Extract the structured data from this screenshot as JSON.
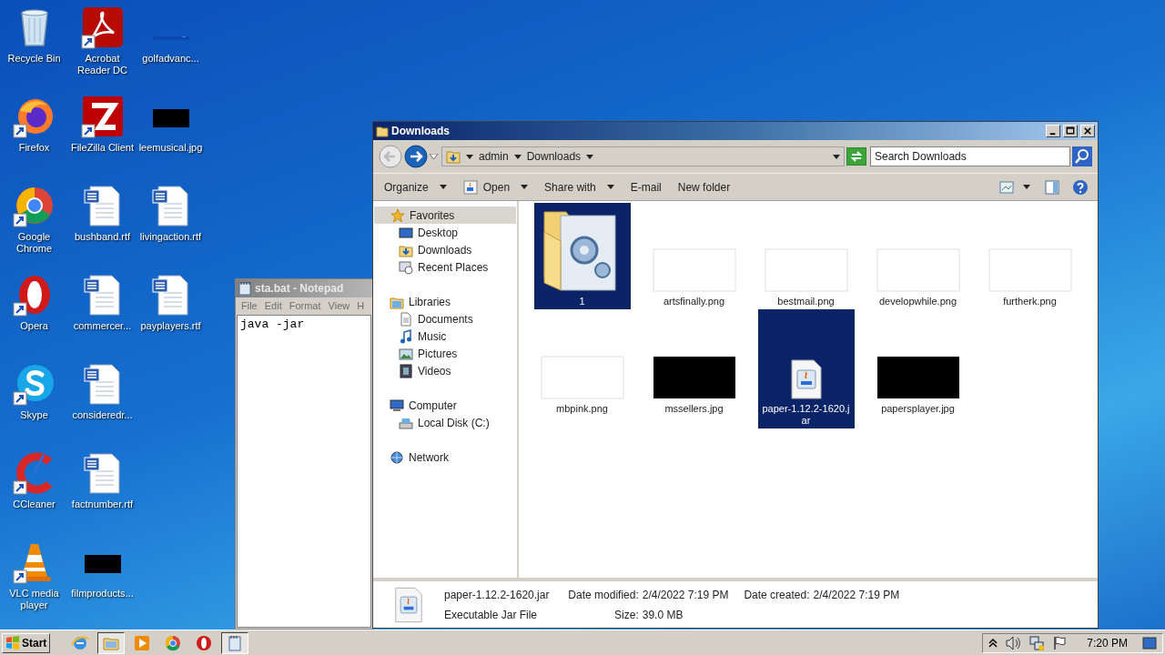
{
  "desktop_icons": [
    {
      "label": "Recycle Bin",
      "kind": "recycle",
      "shortcut": false
    },
    {
      "label": "Firefox",
      "kind": "firefox",
      "shortcut": true
    },
    {
      "label": "Google Chrome",
      "kind": "chrome",
      "shortcut": true
    },
    {
      "label": "Opera",
      "kind": "opera",
      "shortcut": true
    },
    {
      "label": "Skype",
      "kind": "skype",
      "shortcut": true
    },
    {
      "label": "CCleaner",
      "kind": "ccleaner",
      "shortcut": true
    },
    {
      "label": "VLC media player",
      "kind": "vlc",
      "shortcut": true
    },
    {
      "label": "Acrobat Reader DC",
      "kind": "acrobat",
      "shortcut": true
    },
    {
      "label": "FileZilla Client",
      "kind": "filezilla",
      "shortcut": true
    },
    {
      "label": "bushband.rtf",
      "kind": "word",
      "shortcut": false
    },
    {
      "label": "commercer...",
      "kind": "word",
      "shortcut": false
    },
    {
      "label": "consideredr...",
      "kind": "word",
      "shortcut": false
    },
    {
      "label": "factnumber.rtf",
      "kind": "word",
      "shortcut": false
    },
    {
      "label": "filmproducts...",
      "kind": "dark_image",
      "shortcut": false
    },
    {
      "label": "golfadvanc...",
      "kind": "blank_image",
      "shortcut": false
    },
    {
      "label": "leemusical.jpg",
      "kind": "dark_image",
      "shortcut": false
    },
    {
      "label": "livingaction.rtf",
      "kind": "word",
      "shortcut": false
    },
    {
      "label": "payplayers.rtf",
      "kind": "word",
      "shortcut": false
    }
  ],
  "notepad": {
    "title": "sta.bat - Notepad",
    "menu": [
      "File",
      "Edit",
      "Format",
      "View",
      "H"
    ],
    "text": "java -jar"
  },
  "explorer": {
    "title": "Downloads",
    "breadcrumb": [
      "admin",
      "Downloads"
    ],
    "search": {
      "placeholder": "Search Downloads"
    },
    "toolbar": [
      {
        "label": "Organize",
        "dropdown": true,
        "icon": false
      },
      {
        "label": "Open",
        "dropdown": true,
        "icon": true
      },
      {
        "label": "Share with",
        "dropdown": true,
        "icon": false
      },
      {
        "label": "E-mail",
        "dropdown": false,
        "icon": false
      },
      {
        "label": "New folder",
        "dropdown": false,
        "icon": false
      }
    ],
    "nav": [
      {
        "label": "Favorites",
        "kind": "star",
        "children": [
          {
            "label": "Desktop",
            "kind": "desktop"
          },
          {
            "label": "Downloads",
            "kind": "downloads"
          },
          {
            "label": "Recent Places",
            "kind": "recent"
          }
        ],
        "selected": true
      },
      {
        "label": "Libraries",
        "kind": "libraries",
        "children": [
          {
            "label": "Documents",
            "kind": "documents"
          },
          {
            "label": "Music",
            "kind": "music"
          },
          {
            "label": "Pictures",
            "kind": "pictures"
          },
          {
            "label": "Videos",
            "kind": "videos"
          }
        ],
        "selected": false
      },
      {
        "label": "Computer",
        "kind": "computer",
        "children": [
          {
            "label": "Local Disk (C:)",
            "kind": "disk"
          }
        ],
        "selected": false
      },
      {
        "label": "Network",
        "kind": "network",
        "selected": false
      }
    ],
    "files": [
      {
        "name": "1",
        "kind": "folder",
        "selected": true
      },
      {
        "name": "artsfinally.png",
        "kind": "light_image",
        "selected": false
      },
      {
        "name": "bestmail.png",
        "kind": "light_image",
        "selected": false
      },
      {
        "name": "developwhile.png",
        "kind": "light_image",
        "selected": false
      },
      {
        "name": "furtherk.png",
        "kind": "light_image",
        "selected": false
      },
      {
        "name": "mbpink.png",
        "kind": "light_image",
        "selected": false
      },
      {
        "name": "mssellers.jpg",
        "kind": "dark_image",
        "selected": false
      },
      {
        "name": "paper-1.12.2-1620.jar",
        "kind": "jar",
        "selected": true
      },
      {
        "name": "papersplayer.jpg",
        "kind": "dark_image",
        "selected": false
      }
    ],
    "details": {
      "name": "paper-1.12.2-1620.jar",
      "type": "Executable Jar File",
      "properties": [
        {
          "label": "Date modified:",
          "value": "2/4/2022 7:19 PM"
        },
        {
          "label": "Size:",
          "value": "39.0 MB"
        },
        {
          "label": "Date created:",
          "value": "2/4/2022 7:19 PM"
        }
      ]
    }
  },
  "taskbar": {
    "start": "Start",
    "items": [
      {
        "kind": "ie",
        "selected": false
      },
      {
        "kind": "explorer",
        "selected": true
      },
      {
        "kind": "media",
        "selected": false
      },
      {
        "kind": "chrome",
        "selected": false
      },
      {
        "kind": "opera",
        "selected": false
      },
      {
        "kind": "notepad",
        "selected": true
      }
    ],
    "clock": "7:20 PM"
  }
}
